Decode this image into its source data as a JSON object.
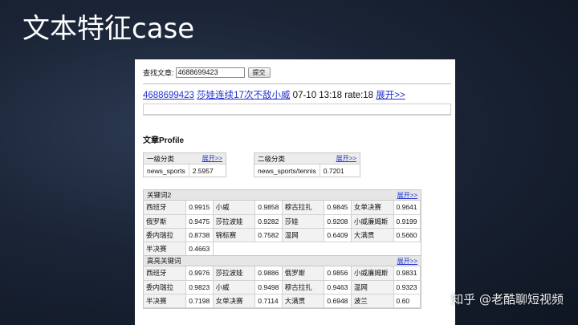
{
  "slide": {
    "title": "文本特征case",
    "watermark": "知乎 @老酷聊短视频"
  },
  "search": {
    "label": "查找文章:",
    "value": "4688699423",
    "submit_label": "提交"
  },
  "article": {
    "id": "4688699423",
    "title": "莎娃连续17次不敌小威",
    "meta": "07-10 13:18 rate:18",
    "expand": "展开>>"
  },
  "profile": {
    "title": "文章Profile",
    "level1": {
      "header": "一级分类",
      "expand": "展开>>",
      "name": "news_sports",
      "score": "2.5957"
    },
    "level2": {
      "header": "二级分类",
      "expand": "展开>>",
      "name": "news_sports/tennis",
      "score": "0.7201"
    }
  },
  "keywords2": {
    "header": "关键词2",
    "expand": "展开>>",
    "rows": [
      [
        [
          "西班牙",
          "0.9915"
        ],
        [
          "小威",
          "0.9858"
        ],
        [
          "穆古拉扎",
          "0.9845"
        ],
        [
          "女单决赛",
          "0.9641"
        ]
      ],
      [
        [
          "俄罗斯",
          "0.9475"
        ],
        [
          "莎拉波娃",
          "0.9282"
        ],
        [
          "莎娃",
          "0.9208"
        ],
        [
          "小威廉姆斯",
          "0.9199"
        ]
      ],
      [
        [
          "委内瑞拉",
          "0.8738"
        ],
        [
          "锦标赛",
          "0.7582"
        ],
        [
          "温网",
          "0.6409"
        ],
        [
          "大满贯",
          "0.5660"
        ]
      ],
      [
        [
          "半决赛",
          "0.4663"
        ]
      ]
    ]
  },
  "keywords_hi": {
    "header": "高亮关键词",
    "expand": "展开>>",
    "rows": [
      [
        [
          "西班牙",
          "0.9976"
        ],
        [
          "莎拉波娃",
          "0.9886"
        ],
        [
          "俄罗斯",
          "0.9856"
        ],
        [
          "小威廉姆斯",
          "0.9831"
        ]
      ],
      [
        [
          "委内瑞拉",
          "0.9823"
        ],
        [
          "小威",
          "0.9498"
        ],
        [
          "穆古拉扎",
          "0.9463"
        ],
        [
          "温网",
          "0.9323"
        ]
      ],
      [
        [
          "半决赛",
          "0.7198"
        ],
        [
          "女单决赛",
          "0.7114"
        ],
        [
          "大满贯",
          "0.6948"
        ],
        [
          "波兰",
          "0.60"
        ]
      ]
    ]
  }
}
